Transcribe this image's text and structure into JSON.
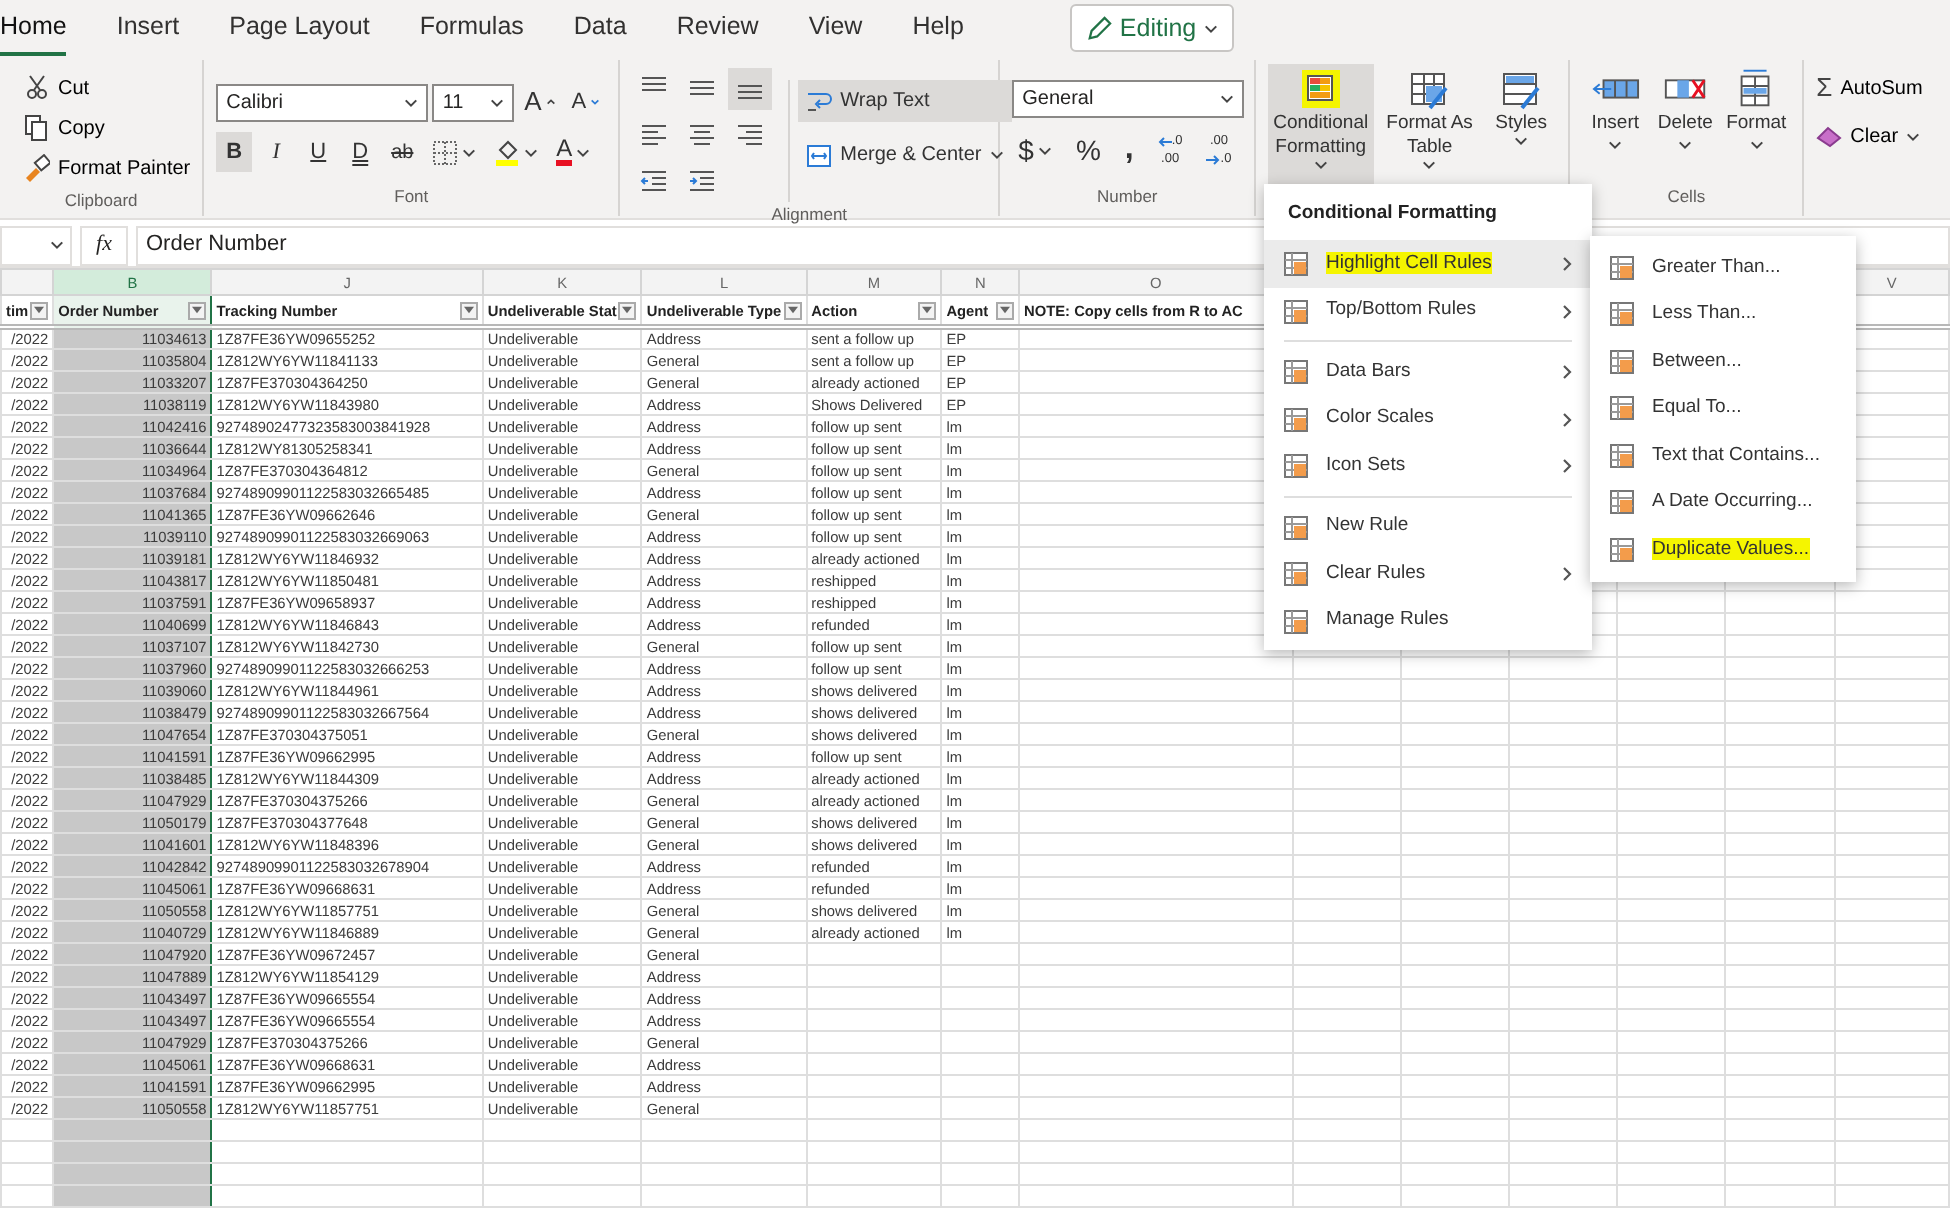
{
  "tabs": [
    {
      "label": "Home",
      "selected": true
    },
    {
      "label": "Insert",
      "selected": false
    },
    {
      "label": "Page Layout",
      "selected": false
    },
    {
      "label": "Formulas",
      "selected": false
    },
    {
      "label": "Data",
      "selected": false
    },
    {
      "label": "Review",
      "selected": false
    },
    {
      "label": "View",
      "selected": false
    },
    {
      "label": "Help",
      "selected": false
    }
  ],
  "editing_button": {
    "label": "Editing"
  },
  "ribbon": {
    "clipboard": {
      "label": "Clipboard",
      "buttons": [
        {
          "kind": "cut",
          "label": "Cut"
        },
        {
          "kind": "copy",
          "label": "Copy"
        },
        {
          "kind": "format_painter",
          "label": "Format Painter"
        }
      ]
    },
    "font": {
      "label": "Font",
      "font_name": "Calibri",
      "font_size": "11",
      "size_buttons": [
        {
          "kind": "grow",
          "label": "A"
        },
        {
          "kind": "shrink",
          "label": "A"
        }
      ],
      "format_buttons": [
        {
          "kind": "bold",
          "label": "B",
          "selected": true
        },
        {
          "kind": "italic",
          "label": "I",
          "selected": false
        },
        {
          "kind": "underline",
          "label": "U",
          "selected": false
        },
        {
          "kind": "double_underline",
          "label": "D",
          "selected": false
        },
        {
          "kind": "strikethrough",
          "label": "ab",
          "selected": false
        }
      ],
      "font_color": {
        "label": "A",
        "color": "#e81123"
      },
      "fill_color": {
        "color": "#ffff00"
      }
    },
    "alignment": {
      "label": "Alignment",
      "icons": [
        {
          "kind": "top",
          "selected": false
        },
        {
          "kind": "middle",
          "selected": false
        },
        {
          "kind": "bottom",
          "selected": true
        },
        {
          "kind": "left",
          "selected": false
        },
        {
          "kind": "center",
          "selected": false
        },
        {
          "kind": "right",
          "selected": false
        },
        {
          "kind": "outdent",
          "selected": false
        },
        {
          "kind": "indent",
          "selected": false
        }
      ],
      "wrap_text": {
        "label": "Wrap Text",
        "selected": true
      },
      "merge": {
        "label": "Merge & Center"
      }
    },
    "number": {
      "label": "Number",
      "format": "General",
      "symbols": [
        {
          "kind": "currency",
          "label": "$"
        },
        {
          "kind": "percent",
          "label": "%"
        },
        {
          "kind": "comma",
          "label": ","
        }
      ],
      "decimals": [
        {
          "kind": "increase",
          "top": ".0",
          "bottom": ".00"
        },
        {
          "kind": "decrease",
          "top": ".00",
          "bottom": ".0"
        }
      ]
    },
    "styles": [
      {
        "kind": "conditional",
        "label": "Conditional Formatting",
        "selected": true,
        "highlighted": true
      },
      {
        "kind": "table",
        "label": "Format As Table",
        "selected": false,
        "highlighted": false
      },
      {
        "kind": "styles",
        "label": "Styles",
        "selected": false,
        "highlighted": false
      }
    ],
    "cells": {
      "label": "Cells",
      "buttons": [
        {
          "kind": "insert",
          "label": "Insert"
        },
        {
          "kind": "delete",
          "label": "Delete"
        },
        {
          "kind": "format",
          "label": "Format"
        }
      ]
    },
    "editing": {
      "buttons": [
        {
          "kind": "autosum",
          "icon": "Σ",
          "label": "AutoSum"
        },
        {
          "kind": "clear",
          "label": "Clear"
        }
      ]
    }
  },
  "formula_bar": {
    "fx": "fx",
    "value": "Order Number"
  },
  "sheet": {
    "columns": [
      {
        "kind": "number",
        "header": "tim",
        "filter": true,
        "selected": false
      },
      {
        "kind": "number",
        "letter": "B",
        "header": "Order Number",
        "filter": true,
        "selected": true
      },
      {
        "kind": "text",
        "letter": "J",
        "header": "Tracking Number",
        "filter": true,
        "selected": false
      },
      {
        "kind": "text",
        "letter": "K",
        "header": "Undeliverable Stat",
        "filter": true,
        "selected": false
      },
      {
        "kind": "text",
        "letter": "L",
        "header": "Undeliverable Type",
        "filter": true,
        "selected": false
      },
      {
        "kind": "text",
        "letter": "M",
        "header": "Action",
        "filter": true,
        "selected": false
      },
      {
        "kind": "text",
        "letter": "N",
        "header": "Agent",
        "filter": true,
        "selected": false
      },
      {
        "kind": "text",
        "letter": "O",
        "header": "NOTE: Copy cells from R to AC",
        "filter": false,
        "selected": false
      },
      {
        "kind": "text",
        "letter": "V",
        "selected": false
      }
    ],
    "rows": [
      [
        "/2022",
        "11034613",
        "1Z87FE36YW09655252",
        "Undeliverable",
        "Address",
        "sent a follow up",
        "EP"
      ],
      [
        "/2022",
        "11035804",
        "1Z812WY6YW11841133",
        "Undeliverable",
        "General",
        "sent a follow up",
        "EP"
      ],
      [
        "/2022",
        "11033207",
        "1Z87FE370304364250",
        "Undeliverable",
        "General",
        "already actioned",
        "EP"
      ],
      [
        "/2022",
        "11038119",
        "1Z812WY6YW11843980",
        "Undeliverable",
        "Address",
        "Shows Delivered",
        "EP"
      ],
      [
        "/2022",
        "11042416",
        "92748902477323583003841928",
        "Undeliverable",
        "Address",
        "follow up sent",
        "lm"
      ],
      [
        "/2022",
        "11036644",
        "1Z812WY81305258341",
        "Undeliverable",
        "Address",
        "follow up sent",
        "lm"
      ],
      [
        "/2022",
        "11034964",
        "1Z87FE370304364812",
        "Undeliverable",
        "General",
        "follow up sent",
        "lm"
      ],
      [
        "/2022",
        "11037684",
        "92748909901122583032665485",
        "Undeliverable",
        "Address",
        "follow up sent",
        "lm"
      ],
      [
        "/2022",
        "11041365",
        "1Z87FE36YW09662646",
        "Undeliverable",
        "General",
        "follow up sent",
        "lm"
      ],
      [
        "/2022",
        "11039110",
        "92748909901122583032669063",
        "Undeliverable",
        "Address",
        "follow up sent",
        "lm"
      ],
      [
        "/2022",
        "11039181",
        "1Z812WY6YW11846932",
        "Undeliverable",
        "Address",
        "already actioned",
        "lm"
      ],
      [
        "/2022",
        "11043817",
        "1Z812WY6YW11850481",
        "Undeliverable",
        "Address",
        "reshipped",
        "lm"
      ],
      [
        "/2022",
        "11037591",
        "1Z87FE36YW09658937",
        "Undeliverable",
        "Address",
        "reshipped",
        "lm"
      ],
      [
        "/2022",
        "11040699",
        "1Z812WY6YW11846843",
        "Undeliverable",
        "Address",
        "refunded",
        "lm"
      ],
      [
        "/2022",
        "11037107",
        "1Z812WY6YW11842730",
        "Undeliverable",
        "General",
        "follow up sent",
        "lm"
      ],
      [
        "/2022",
        "11037960",
        "92748909901122583032666253",
        "Undeliverable",
        "Address",
        "follow up sent",
        "lm"
      ],
      [
        "/2022",
        "11039060",
        "1Z812WY6YW11844961",
        "Undeliverable",
        "Address",
        "shows delivered",
        "lm"
      ],
      [
        "/2022",
        "11038479",
        "92748909901122583032667564",
        "Undeliverable",
        "Address",
        "shows delivered",
        "lm"
      ],
      [
        "/2022",
        "11047654",
        "1Z87FE370304375051",
        "Undeliverable",
        "General",
        "shows delivered",
        "lm"
      ],
      [
        "/2022",
        "11041591",
        "1Z87FE36YW09662995",
        "Undeliverable",
        "Address",
        "follow up sent",
        "lm"
      ],
      [
        "/2022",
        "11038485",
        "1Z812WY6YW11844309",
        "Undeliverable",
        "Address",
        "already actioned",
        "lm"
      ],
      [
        "/2022",
        "11047929",
        "1Z87FE370304375266",
        "Undeliverable",
        "General",
        "already actioned",
        "lm"
      ],
      [
        "/2022",
        "11050179",
        "1Z87FE370304377648",
        "Undeliverable",
        "General",
        "shows delivered",
        "lm"
      ],
      [
        "/2022",
        "11041601",
        "1Z812WY6YW11848396",
        "Undeliverable",
        "General",
        "shows delivered",
        "lm"
      ],
      [
        "/2022",
        "11042842",
        "92748909901122583032678904",
        "Undeliverable",
        "Address",
        "refunded",
        "lm"
      ],
      [
        "/2022",
        "11045061",
        "1Z87FE36YW09668631",
        "Undeliverable",
        "Address",
        "refunded",
        "lm"
      ],
      [
        "/2022",
        "11050558",
        "1Z812WY6YW11857751",
        "Undeliverable",
        "General",
        "shows delivered",
        "lm"
      ],
      [
        "/2022",
        "11040729",
        "1Z812WY6YW11846889",
        "Undeliverable",
        "General",
        "already actioned",
        "lm"
      ],
      [
        "/2022",
        "11047920",
        "1Z87FE36YW09672457",
        "Undeliverable",
        "General"
      ],
      [
        "/2022",
        "11047889",
        "1Z812WY6YW11854129",
        "Undeliverable",
        "Address"
      ],
      [
        "/2022",
        "11043497",
        "1Z87FE36YW09665554",
        "Undeliverable",
        "Address"
      ],
      [
        "/2022",
        "11043497",
        "1Z87FE36YW09665554",
        "Undeliverable",
        "Address"
      ],
      [
        "/2022",
        "11047929",
        "1Z87FE370304375266",
        "Undeliverable",
        "General"
      ],
      [
        "/2022",
        "11045061",
        "1Z87FE36YW09668631",
        "Undeliverable",
        "Address"
      ],
      [
        "/2022",
        "11041591",
        "1Z87FE36YW09662995",
        "Undeliverable",
        "Address"
      ],
      [
        "/2022",
        "11050558",
        "1Z812WY6YW11857751",
        "Undeliverable",
        "General"
      ]
    ]
  },
  "menu": {
    "title": "Conditional Formatting",
    "sections": [
      [
        {
          "label": "Highlight Cell Rules",
          "submenu": true,
          "selected": true,
          "highlighted": true
        },
        {
          "label": "Top/Bottom Rules",
          "submenu": true,
          "selected": false,
          "highlighted": false
        }
      ],
      [
        {
          "label": "Data Bars",
          "submenu": true,
          "selected": false,
          "highlighted": false
        },
        {
          "label": "Color Scales",
          "submenu": true,
          "selected": false,
          "highlighted": false
        },
        {
          "label": "Icon Sets",
          "submenu": true,
          "selected": false,
          "highlighted": false
        }
      ],
      [
        {
          "label": "New Rule",
          "submenu": false,
          "selected": false,
          "highlighted": false
        },
        {
          "label": "Clear Rules",
          "submenu": true,
          "selected": false,
          "highlighted": false
        },
        {
          "label": "Manage Rules",
          "submenu": false,
          "selected": false,
          "highlighted": false
        }
      ]
    ]
  },
  "submenu": {
    "items": [
      {
        "label": "Greater Than...",
        "highlighted": false
      },
      {
        "label": "Less Than...",
        "highlighted": false
      },
      {
        "label": "Between...",
        "highlighted": false
      },
      {
        "label": "Equal To...",
        "highlighted": false
      },
      {
        "label": "Text that Contains...",
        "highlighted": false
      },
      {
        "label": "A Date Occurring...",
        "highlighted": false
      },
      {
        "label": "Duplicate Values...",
        "highlighted": true
      }
    ]
  }
}
